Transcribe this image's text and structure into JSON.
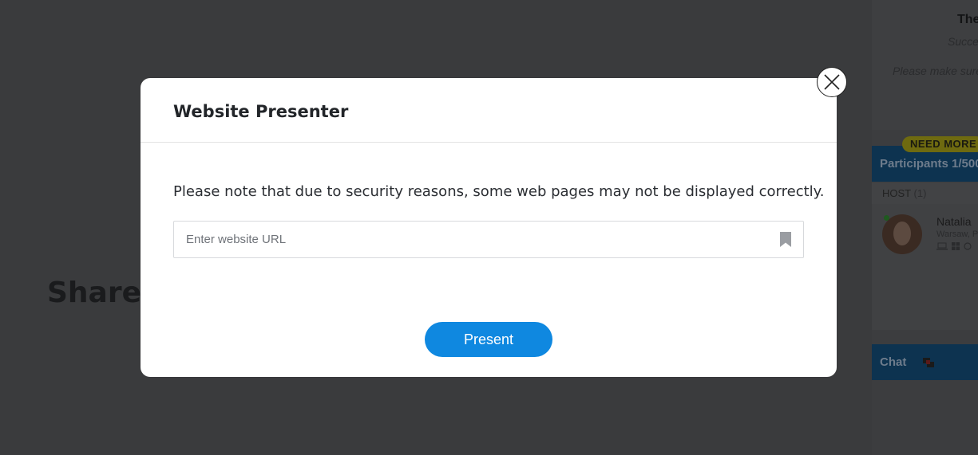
{
  "background": {
    "heading": "Shared",
    "sidebar": {
      "notice_title": "The",
      "notice_subtitle": "Succe",
      "notice_note": "Please make sure",
      "upsell_badge": "NEED MORE",
      "participants_header": "Participants 1/500",
      "host_label": "HOST",
      "host_count": "(1)",
      "participant": {
        "name": "Natalia",
        "location": "Warsaw, P",
        "status": "online"
      },
      "chat_header": "Chat"
    }
  },
  "modal": {
    "title": "Website Presenter",
    "note": "Please note that due to security reasons, some web pages may not be displayed correctly.",
    "url_placeholder": "Enter website URL",
    "url_value": "",
    "present_label": "Present",
    "icons": {
      "close": "close-icon",
      "bookmark": "bookmark-icon"
    }
  },
  "colors": {
    "overlay": "#3a3b3d",
    "accent": "#0f88e0",
    "modal_bg": "#ffffff",
    "sidebar_header": "#0d3350",
    "upsell_badge": "#6e6a10"
  }
}
